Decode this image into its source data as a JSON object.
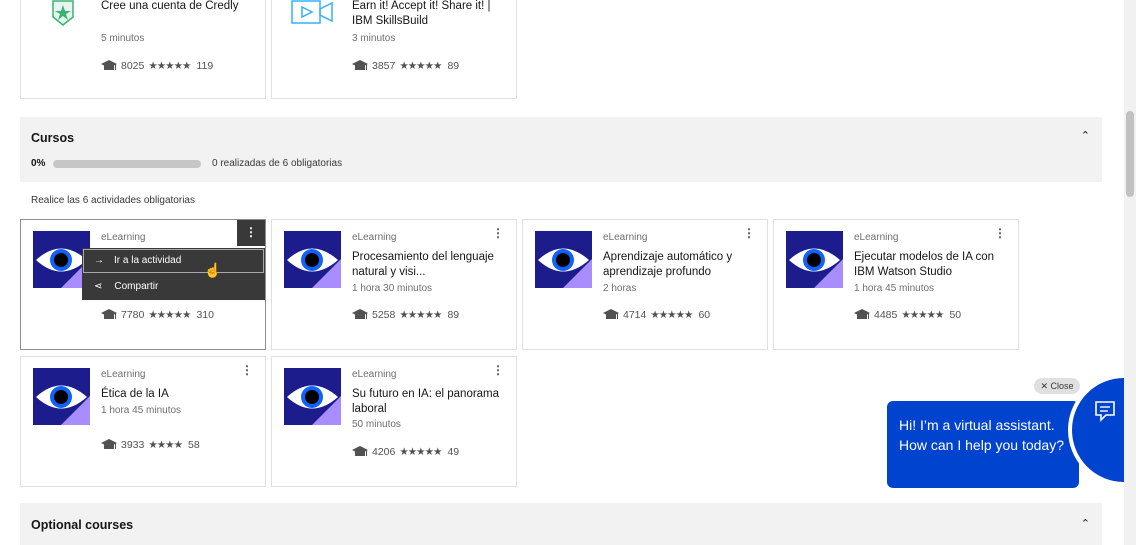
{
  "top_cards": [
    {
      "title": "Cree una cuenta de Credly",
      "duration": "5 minutos",
      "learners": "8025",
      "reviews": "119",
      "icon": "badge-icon"
    },
    {
      "title": "Earn it! Accept it! Share it! | IBM SkillsBuild",
      "duration": "3 minutos",
      "learners": "3857",
      "reviews": "89",
      "icon": "video-icon"
    }
  ],
  "cursos": {
    "title": "Cursos",
    "progress_pct": "0%",
    "progress_value": 0,
    "progress_text": "0 realizadas de 6 obligatorias",
    "note": "Realice las 6 actividades obligatorias"
  },
  "menu": {
    "go": "Ir a la actividad",
    "share": "Compartir"
  },
  "courses": [
    {
      "kind": "eLearning",
      "title": "",
      "duration": "",
      "learners": "7780",
      "reviews": "310"
    },
    {
      "kind": "eLearning",
      "title": "Procesamiento del lenguaje natural y visi...",
      "duration": "1 hora 30 minutos",
      "learners": "5258",
      "reviews": "89"
    },
    {
      "kind": "eLearning",
      "title": "Aprendizaje automático y aprendizaje profundo",
      "duration": "2 horas",
      "learners": "4714",
      "reviews": "60"
    },
    {
      "kind": "eLearning",
      "title": "Ejecutar modelos de IA con IBM Watson Studio",
      "duration": "1 hora 45 minutos",
      "learners": "4485",
      "reviews": "50"
    },
    {
      "kind": "eLearning",
      "title": "Ética de la IA",
      "duration": "1 hora 45 minutos",
      "learners": "3933",
      "reviews": "58"
    },
    {
      "kind": "eLearning",
      "title": "Su futuro en IA: el panorama laboral",
      "duration": "50 minutos",
      "learners": "4206",
      "reviews": "49"
    }
  ],
  "optional": {
    "title": "Optional courses"
  },
  "assistant": {
    "close": "Close",
    "message": "Hi! I’m a virtual assistant. How can I help you today?"
  },
  "colors": {
    "accent": "#0043ce",
    "assistant": "#0043ce"
  }
}
